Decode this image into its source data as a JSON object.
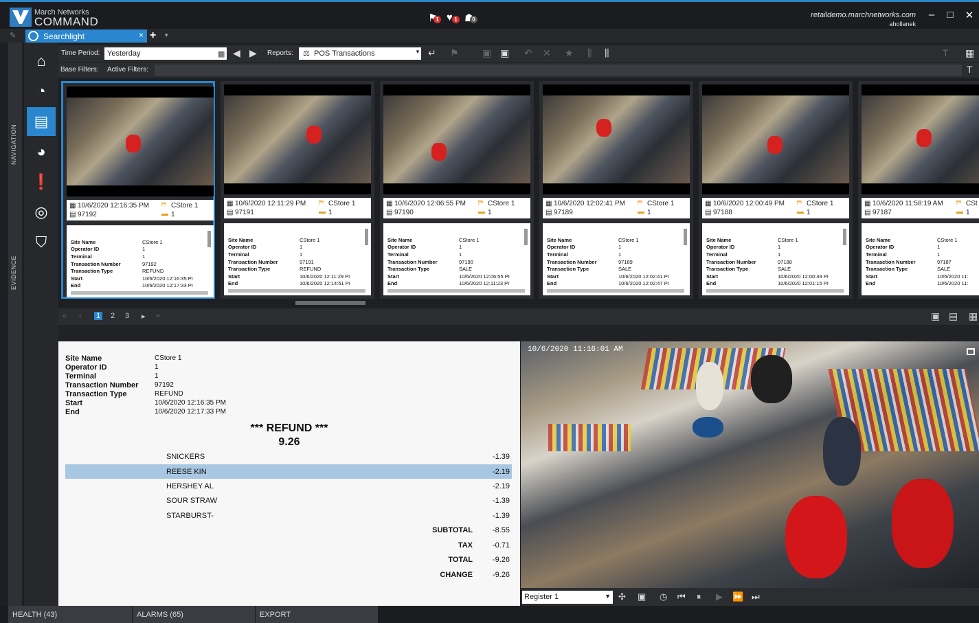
{
  "app": {
    "brand_small": "March Networks",
    "brand_big": "COMMAND",
    "server_url": "retaildemo.marchnetworks.com",
    "user": "ahollanek",
    "alerts": [
      {
        "icon": "alarm-badge-icon",
        "badge": "1"
      },
      {
        "icon": "health-badge-icon",
        "badge": "1"
      },
      {
        "icon": "user-badge-icon",
        "badge": "0"
      }
    ],
    "window_controls": {
      "minimize": "–",
      "maximize": "□",
      "close": "✕"
    },
    "accent_color": "#2a86cf"
  },
  "tabs": [
    {
      "label": "Searchlight",
      "close": "×"
    }
  ],
  "add_tab": "+",
  "side_tabs": {
    "navigation": "NAVIGATION",
    "evidence": "EVIDENCE"
  },
  "toolbar": {
    "time_period_label": "Time Period:",
    "time_period_value": "Yesterday",
    "reports_label": "Reports:",
    "reports_value": "POS Transactions",
    "base_filters_label": "Base Filters:",
    "active_filters_label": "Active Filters:"
  },
  "transactions": [
    {
      "datetime": "10/6/2020 12:16:35 PM",
      "site": "CStore 1",
      "txn": "97192",
      "count": "1",
      "details": {
        "Site Name": "CStore 1",
        "Operator ID": "1",
        "Terminal": "1",
        "Transaction Number": "97192",
        "Transaction Type": "REFUND",
        "Start": "10/6/2020 12:16:35 PI",
        "End": "10/6/2020 12:17:33 PI"
      }
    },
    {
      "datetime": "10/6/2020 12:11:29 PM",
      "site": "CStore 1",
      "txn": "97191",
      "count": "1",
      "details": {
        "Site Name": "CStore 1",
        "Operator ID": "1",
        "Terminal": "1",
        "Transaction Number": "97191",
        "Transaction Type": "REFUND",
        "Start": "10/6/2020 12:11:29 PI",
        "End": "10/6/2020 12:14:51 PI"
      }
    },
    {
      "datetime": "10/6/2020 12:06:55 PM",
      "site": "CStore 1",
      "txn": "97190",
      "count": "1",
      "details": {
        "Site Name": "CStore 1",
        "Operator ID": "1",
        "Terminal": "1",
        "Transaction Number": "97190",
        "Transaction Type": "SALE",
        "Start": "10/6/2020 12:06:55 PI",
        "End": "10/6/2020 12:11:23 PI"
      }
    },
    {
      "datetime": "10/6/2020 12:02:41 PM",
      "site": "CStore 1",
      "txn": "97189",
      "count": "1",
      "details": {
        "Site Name": "CStore 1",
        "Operator ID": "1",
        "Terminal": "1",
        "Transaction Number": "97189",
        "Transaction Type": "SALE",
        "Start": "10/6/2020 12:02:41 PI",
        "End": "10/6/2020 12:02:47 PI"
      }
    },
    {
      "datetime": "10/6/2020 12:00:49 PM",
      "site": "CStore 1",
      "txn": "97188",
      "count": "1",
      "details": {
        "Site Name": "CStore 1",
        "Operator ID": "1",
        "Terminal": "1",
        "Transaction Number": "97188",
        "Transaction Type": "SALE",
        "Start": "10/6/2020 12:00:49 PI",
        "End": "10/6/2020 12:01:15 PI"
      }
    },
    {
      "datetime": "10/6/2020 11:58:19 AM",
      "site": "CSt",
      "txn": "97187",
      "count": "1",
      "details": {
        "Site Name": "CStore 1",
        "Operator ID": "1",
        "Terminal": "1",
        "Transaction Number": "97187",
        "Transaction Type": "SALE",
        "Start": "10/6/2020 11:",
        "End": "10/6/2020 11:"
      }
    }
  ],
  "pager": {
    "pages": [
      "1",
      "2",
      "3"
    ],
    "active": "1"
  },
  "selected": {
    "header": [
      {
        "key": "Site Name",
        "value": "CStore 1"
      },
      {
        "key": "Operator ID",
        "value": "1"
      },
      {
        "key": "Terminal",
        "value": "1"
      },
      {
        "key": "Transaction Number",
        "value": "97192"
      },
      {
        "key": "Transaction Type",
        "value": "REFUND"
      },
      {
        "key": "Start",
        "value": "10/6/2020 12:16:35 PM"
      },
      {
        "key": "End",
        "value": "10/6/2020 12:17:33 PM"
      }
    ],
    "title": "*** REFUND ***",
    "amount": "9.26",
    "items": [
      {
        "name": "SNICKERS",
        "amount": "-1.39"
      },
      {
        "name": "REESE  KIN",
        "amount": "-2.19",
        "highlighted": true
      },
      {
        "name": "HERSHEY AL",
        "amount": "-2.19"
      },
      {
        "name": "SOUR STRAW",
        "amount": "-1.39"
      },
      {
        "name": "STARBURST-",
        "amount": "-1.39"
      }
    ],
    "totals": [
      {
        "name": "SUBTOTAL",
        "amount": "-8.55"
      },
      {
        "name": "TAX",
        "amount": "-0.71"
      },
      {
        "name": "TOTAL",
        "amount": "-9.26"
      },
      {
        "name": "CHANGE",
        "amount": "-9.26"
      }
    ]
  },
  "video": {
    "timestamp": "10/6/2020 11:16:01 AM",
    "camera": "Register 1"
  },
  "statusbar": {
    "health": "HEALTH (43)",
    "alarms": "ALARMS (65)",
    "export": "EXPORT"
  }
}
